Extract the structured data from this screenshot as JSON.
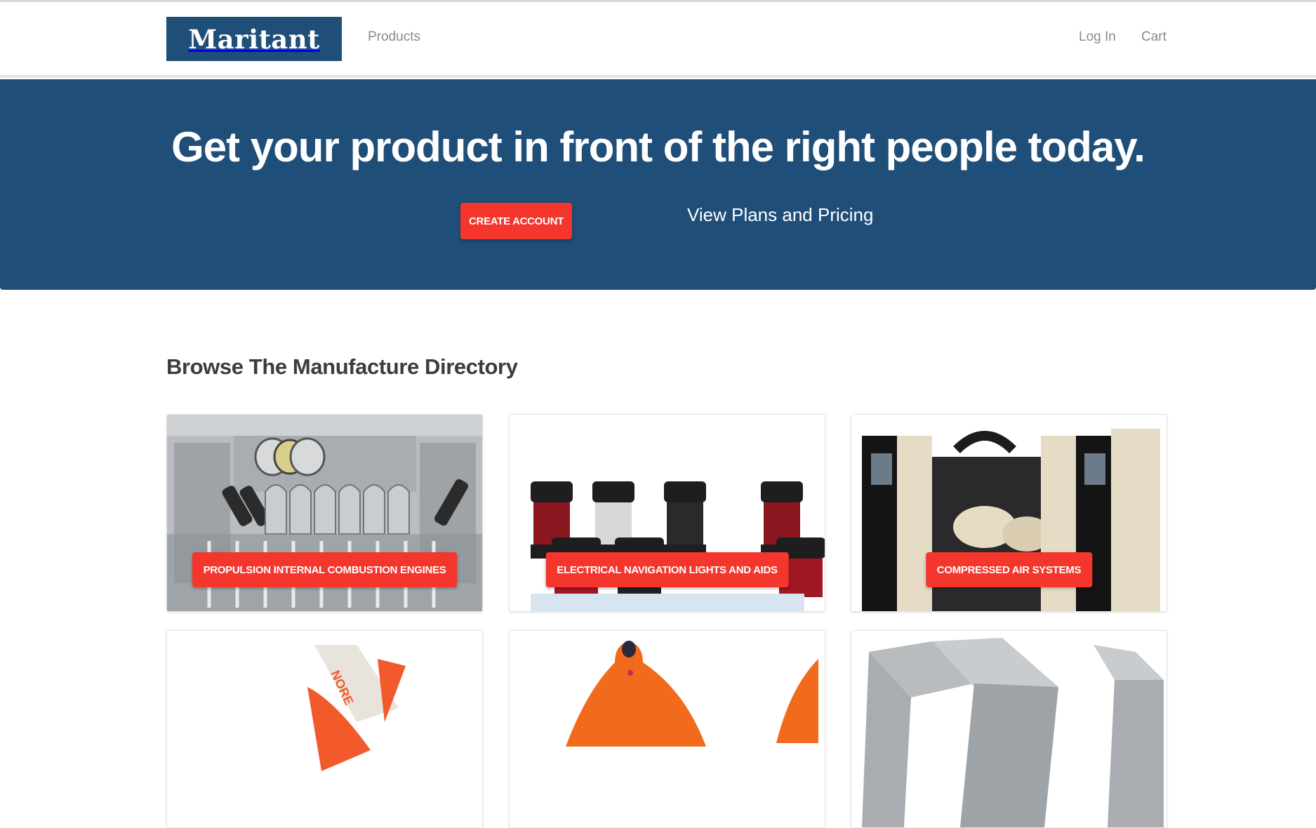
{
  "brand": {
    "logo_text": "Maritant",
    "primary_color": "#1f4e79",
    "accent_color": "#f4362c"
  },
  "nav": {
    "products": "Products",
    "login": "Log In",
    "cart": "Cart"
  },
  "hero": {
    "title": "Get your product in front of the right people today.",
    "create_account": "CREATE ACCOUNT",
    "view_plans": "View Plans and Pricing"
  },
  "directory": {
    "title": "Browse The Manufacture Directory",
    "categories": [
      {
        "label": "PROPULSION INTERNAL COMBUSTION ENGINES",
        "image": "engine-image"
      },
      {
        "label": "ELECTRICAL NAVIGATION LIGHTS AND AIDS",
        "image": "navigation-lights-image"
      },
      {
        "label": "COMPRESSED AIR SYSTEMS",
        "image": "air-compressor-image"
      },
      {
        "label": "",
        "image": "liferaft-image"
      },
      {
        "label": "",
        "image": "buoy-image"
      },
      {
        "label": "",
        "image": "honeycomb-panel-image"
      }
    ]
  }
}
